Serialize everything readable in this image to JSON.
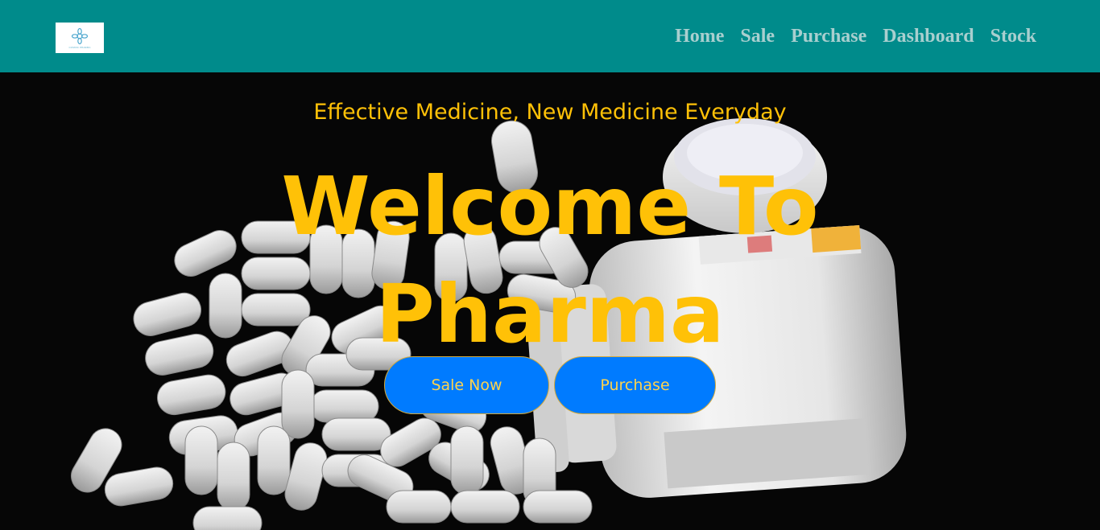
{
  "header": {
    "logo": {
      "icon": "flower-logo-icon",
      "text": "COSMIC PHARMA"
    },
    "nav": [
      {
        "label": "Home"
      },
      {
        "label": "Sale"
      },
      {
        "label": "Purchase"
      },
      {
        "label": "Dashboard"
      },
      {
        "label": "Stock"
      }
    ]
  },
  "hero": {
    "tagline": "Effective Medicine, New Medicine Everyday",
    "headline": "Welcome To Pharma",
    "buttons": {
      "sale_label": "Sale Now",
      "purchase_label": "Purchase"
    },
    "background": "pills-and-bottle-photo"
  },
  "colors": {
    "navbar": "#008b8b",
    "nav_text": "#a9cfcf",
    "accent": "#ffc107",
    "button": "#007bff"
  }
}
